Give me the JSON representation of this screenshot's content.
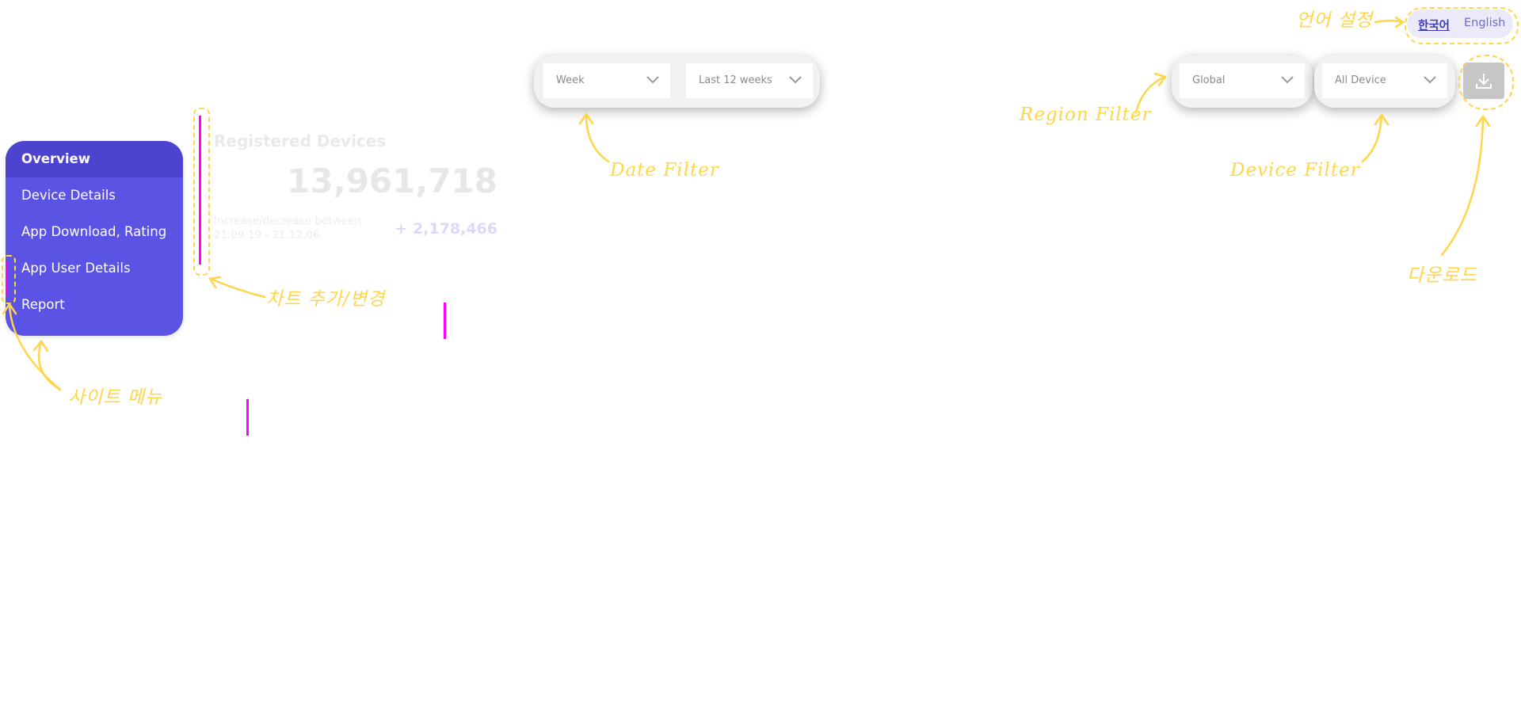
{
  "menu": {
    "items": [
      "Overview",
      "Device Details",
      "App Download, Rating",
      "App User Details",
      "Report"
    ],
    "active_index": 0
  },
  "registered": {
    "title": "Registered Devices",
    "value": "13,961,718",
    "note_line1": "Increase/decrease between",
    "note_line2": "21.09.19 - 21.12.06",
    "change": "+ 2,178,466"
  },
  "filters": {
    "period": "Week",
    "range": "Last 12 weeks",
    "region": "Global",
    "device": "All Device"
  },
  "language": {
    "korean": "한국어",
    "english": "English"
  },
  "annotations": {
    "language_setting": "언어 설정",
    "region_filter": "Region Filter",
    "date_filter": "Date Filter",
    "device_filter": "Device Filter",
    "download": "다운로드",
    "chart_change": "차트 추가/변경",
    "site_menu": "사이트 메뉴"
  },
  "colors": {
    "menu_bg": "#5b53e3",
    "menu_active": "#4c43cf",
    "annotation": "#ffd54a",
    "marker": "#ff00ff"
  },
  "icons": {
    "download": "download-icon",
    "dropdown": "chevron-down-icon"
  }
}
